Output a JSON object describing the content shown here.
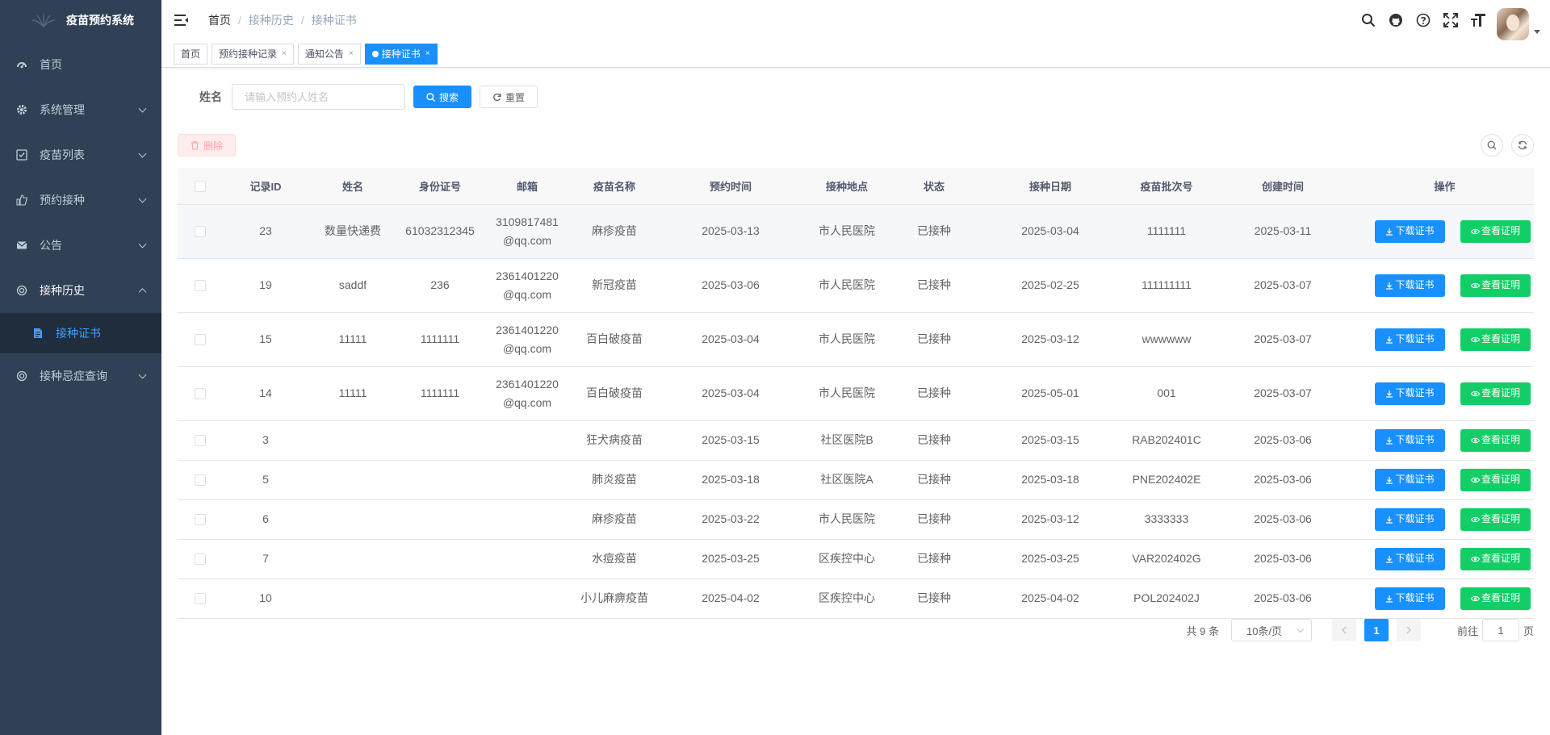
{
  "app": {
    "title": "疫苗预约系统"
  },
  "sidebar": {
    "items": [
      {
        "label": "首页",
        "icon": "dashboard-icon"
      },
      {
        "label": "系统管理",
        "icon": "gear-icon"
      },
      {
        "label": "疫苗列表",
        "icon": "checkbox-icon"
      },
      {
        "label": "预约接种",
        "icon": "thumb-icon"
      },
      {
        "label": "公告",
        "icon": "mail-icon"
      },
      {
        "label": "接种历史",
        "icon": "history-icon"
      },
      {
        "label": "接种证书",
        "icon": "document-icon"
      },
      {
        "label": "接种忌症查询",
        "icon": "query-icon"
      }
    ]
  },
  "breadcrumb": [
    "首页",
    "接种历史",
    "接种证书"
  ],
  "tags": [
    {
      "label": "首页"
    },
    {
      "label": "预约接种记录",
      "close": "×"
    },
    {
      "label": "通知公告",
      "close": "×"
    },
    {
      "label": "接种证书",
      "close": "×"
    }
  ],
  "search": {
    "label": "姓名",
    "placeholder": "请输入预约人姓名",
    "search_label": "搜索",
    "reset_label": "重置"
  },
  "toolbar": {
    "delete_label": "删除"
  },
  "table": {
    "headers": [
      "记录ID",
      "姓名",
      "身份证号",
      "邮箱",
      "疫苗名称",
      "预约时间",
      "接种地点",
      "状态",
      "接种日期",
      "疫苗批次号",
      "创建时间",
      "操作"
    ],
    "download_label": "下载证书",
    "view_label": "查看证明",
    "rows": [
      {
        "id": "23",
        "name": "数量快递费",
        "idcard": "61032312345",
        "email1": "3109817481",
        "email2": "@qq.com",
        "vaccine": "麻疹疫苗",
        "appt": "2025-03-13",
        "place": "市人民医院",
        "status": "已接种",
        "date": "2025-03-04",
        "batch": "1111111",
        "created": "2025-03-11"
      },
      {
        "id": "19",
        "name": "saddf",
        "idcard": "236",
        "email1": "2361401220",
        "email2": "@qq.com",
        "vaccine": "新冠疫苗",
        "appt": "2025-03-06",
        "place": "市人民医院",
        "status": "已接种",
        "date": "2025-02-25",
        "batch": "111111111",
        "created": "2025-03-07"
      },
      {
        "id": "15",
        "name": "11111",
        "idcard": "1111111",
        "email1": "2361401220",
        "email2": "@qq.com",
        "vaccine": "百白破疫苗",
        "appt": "2025-03-04",
        "place": "市人民医院",
        "status": "已接种",
        "date": "2025-03-12",
        "batch": "wwwwww",
        "created": "2025-03-07"
      },
      {
        "id": "14",
        "name": "11111",
        "idcard": "1111111",
        "email1": "2361401220",
        "email2": "@qq.com",
        "vaccine": "百白破疫苗",
        "appt": "2025-03-04",
        "place": "市人民医院",
        "status": "已接种",
        "date": "2025-05-01",
        "batch": "001",
        "created": "2025-03-07"
      },
      {
        "id": "3",
        "name": "",
        "idcard": "",
        "email1": "",
        "email2": "",
        "vaccine": "狂犬病疫苗",
        "appt": "2025-03-15",
        "place": "社区医院B",
        "status": "已接种",
        "date": "2025-03-15",
        "batch": "RAB202401C",
        "created": "2025-03-06"
      },
      {
        "id": "5",
        "name": "",
        "idcard": "",
        "email1": "",
        "email2": "",
        "vaccine": "肺炎疫苗",
        "appt": "2025-03-18",
        "place": "社区医院A",
        "status": "已接种",
        "date": "2025-03-18",
        "batch": "PNE202402E",
        "created": "2025-03-06"
      },
      {
        "id": "6",
        "name": "",
        "idcard": "",
        "email1": "",
        "email2": "",
        "vaccine": "麻疹疫苗",
        "appt": "2025-03-22",
        "place": "市人民医院",
        "status": "已接种",
        "date": "2025-03-12",
        "batch": "3333333",
        "created": "2025-03-06"
      },
      {
        "id": "7",
        "name": "",
        "idcard": "",
        "email1": "",
        "email2": "",
        "vaccine": "水痘疫苗",
        "appt": "2025-03-25",
        "place": "区疾控中心",
        "status": "已接种",
        "date": "2025-03-25",
        "batch": "VAR202402G",
        "created": "2025-03-06"
      },
      {
        "id": "10",
        "name": "",
        "idcard": "",
        "email1": "",
        "email2": "",
        "vaccine": "小儿麻痹疫苗",
        "appt": "2025-04-02",
        "place": "区疾控中心",
        "status": "已接种",
        "date": "2025-04-02",
        "batch": "POL202402J",
        "created": "2025-03-06"
      }
    ]
  },
  "pagination": {
    "total": "共 9 条",
    "page_size": "10条/页",
    "current": "1",
    "goto_prefix": "前往",
    "goto_value": "1",
    "goto_suffix": "页"
  },
  "colors": {
    "sidebar_bg": "#304156",
    "primary": "#1890ff",
    "success": "#13ce66",
    "active_menu": "#409eff"
  }
}
